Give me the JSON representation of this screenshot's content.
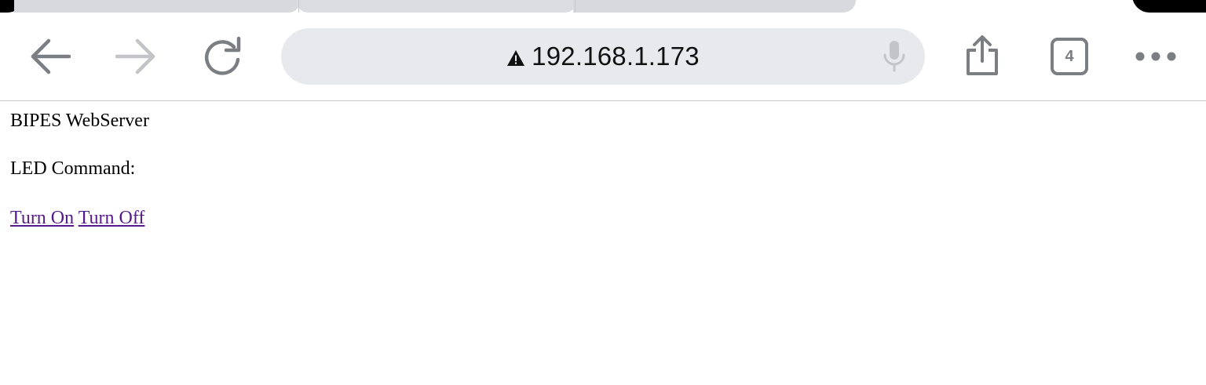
{
  "browser": {
    "address": "192.168.1.173",
    "tab_count": "4",
    "icons": {
      "back": "back-arrow-icon",
      "forward": "forward-arrow-icon",
      "reload": "reload-icon",
      "warning": "warning-triangle-icon",
      "mic": "microphone-icon",
      "share": "share-icon",
      "tabs": "tabs-icon",
      "more": "more-icon"
    },
    "colors": {
      "address_bar_bg": "#e8e9ec",
      "icon_gray": "#7b7f83",
      "icon_disabled": "#c2c4c7"
    }
  },
  "page": {
    "title_text": "BIPES WebServer",
    "led_label": "LED Command:",
    "links": [
      {
        "label": "Turn On"
      },
      {
        "label": "Turn Off"
      }
    ],
    "colors": {
      "link_visited": "#551a8b"
    }
  }
}
